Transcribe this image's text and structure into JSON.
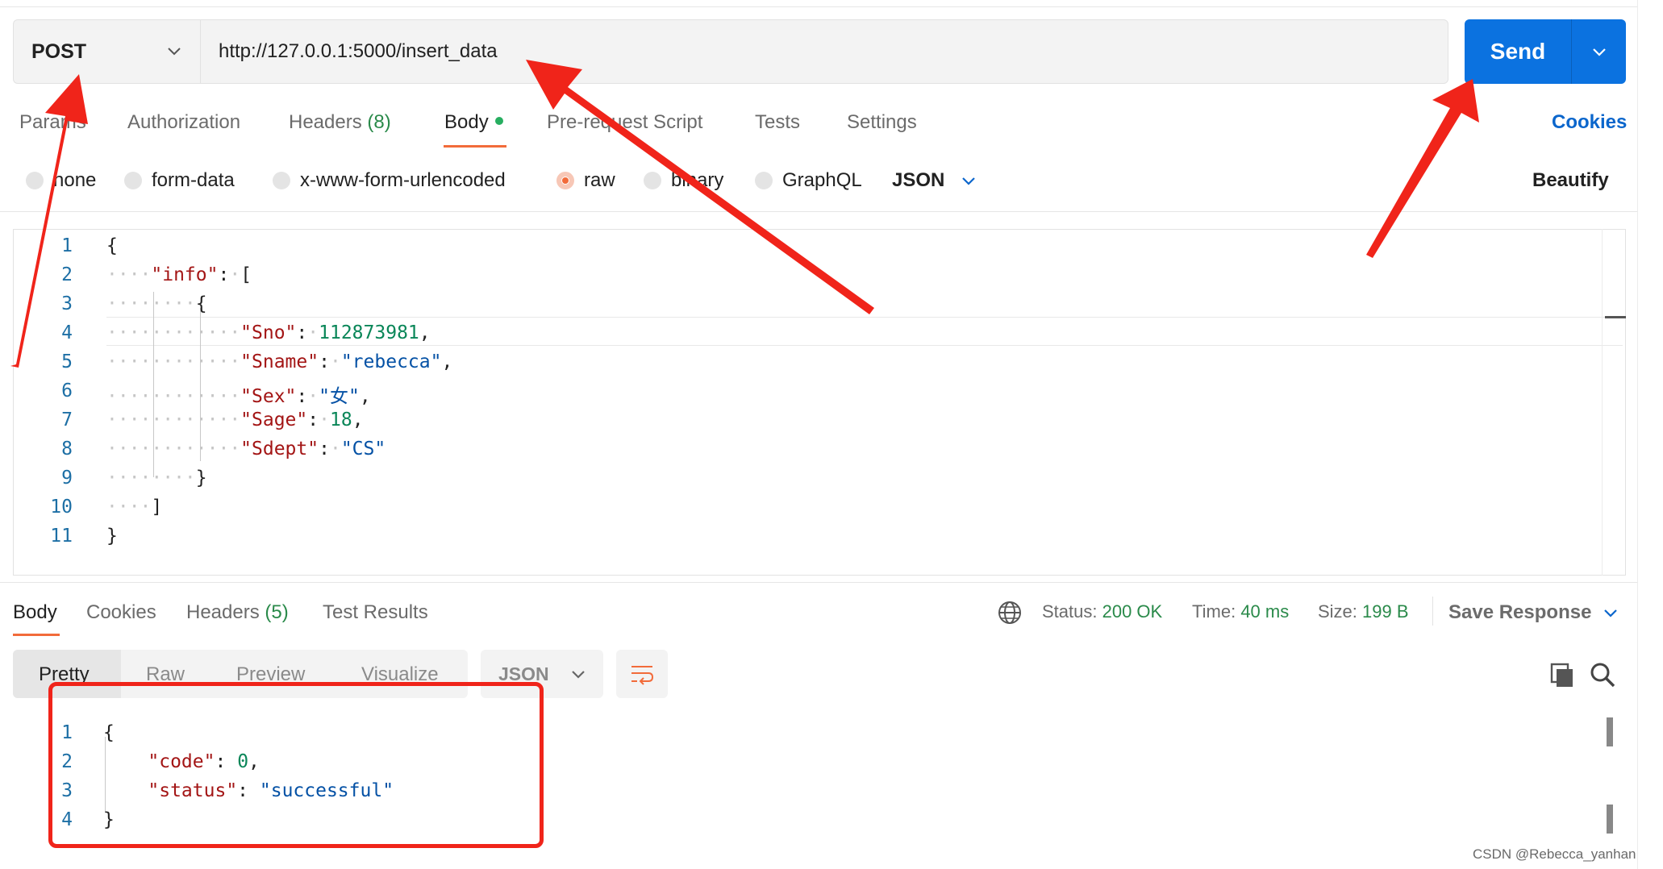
{
  "request": {
    "method": "POST",
    "url": "http://127.0.0.1:5000/insert_data",
    "send_label": "Send"
  },
  "request_tabs": {
    "params": "Params",
    "authorization": "Authorization",
    "headers": "Headers",
    "headers_count": "(8)",
    "body": "Body",
    "prerequest": "Pre-request Script",
    "tests": "Tests",
    "settings": "Settings",
    "cookies": "Cookies"
  },
  "body_types": {
    "none": "none",
    "form_data": "form-data",
    "urlencoded": "x-www-form-urlencoded",
    "raw": "raw",
    "binary": "binary",
    "graphql": "GraphQL",
    "format": "JSON",
    "beautify": "Beautify"
  },
  "request_body": {
    "line_numbers": [
      "1",
      "2",
      "3",
      "4",
      "5",
      "6",
      "7",
      "8",
      "9",
      "10",
      "11"
    ],
    "key_info": "\"info\"",
    "fields": [
      {
        "key": "\"Sno\"",
        "value": "112873981",
        "kind": "n",
        "trail": ","
      },
      {
        "key": "\"Sname\"",
        "value": "\"rebecca\"",
        "kind": "s",
        "trail": ","
      },
      {
        "key": "\"Sex\"",
        "value": "\"女\"",
        "kind": "s",
        "trail": ","
      },
      {
        "key": "\"Sage\"",
        "value": "18",
        "kind": "n",
        "trail": ","
      },
      {
        "key": "\"Sdept\"",
        "value": "\"CS\"",
        "kind": "s",
        "trail": ""
      }
    ]
  },
  "response_tabs": {
    "body": "Body",
    "cookies": "Cookies",
    "headers": "Headers",
    "headers_count": "(5)",
    "test_results": "Test Results"
  },
  "response_status": {
    "status_label": "Status:",
    "status_value": "200 OK",
    "time_label": "Time:",
    "time_value": "40 ms",
    "size_label": "Size:",
    "size_value": "199 B",
    "save_response": "Save Response"
  },
  "response_view": {
    "pretty": "Pretty",
    "raw": "Raw",
    "preview": "Preview",
    "visualize": "Visualize",
    "format": "JSON"
  },
  "response_body": {
    "line_numbers": [
      "1",
      "2",
      "3",
      "4"
    ],
    "fields": [
      {
        "key": "\"code\"",
        "value": "0",
        "kind": "n",
        "trail": ","
      },
      {
        "key": "\"status\"",
        "value": "\"successful\"",
        "kind": "s",
        "trail": ""
      }
    ]
  },
  "watermark": "CSDN @Rebecca_yanhan",
  "colors": {
    "send_button": "#0b72e0",
    "active_tab": "#f26b3a",
    "annotation": "#f0241a",
    "status_ok": "#2a8a4a"
  }
}
